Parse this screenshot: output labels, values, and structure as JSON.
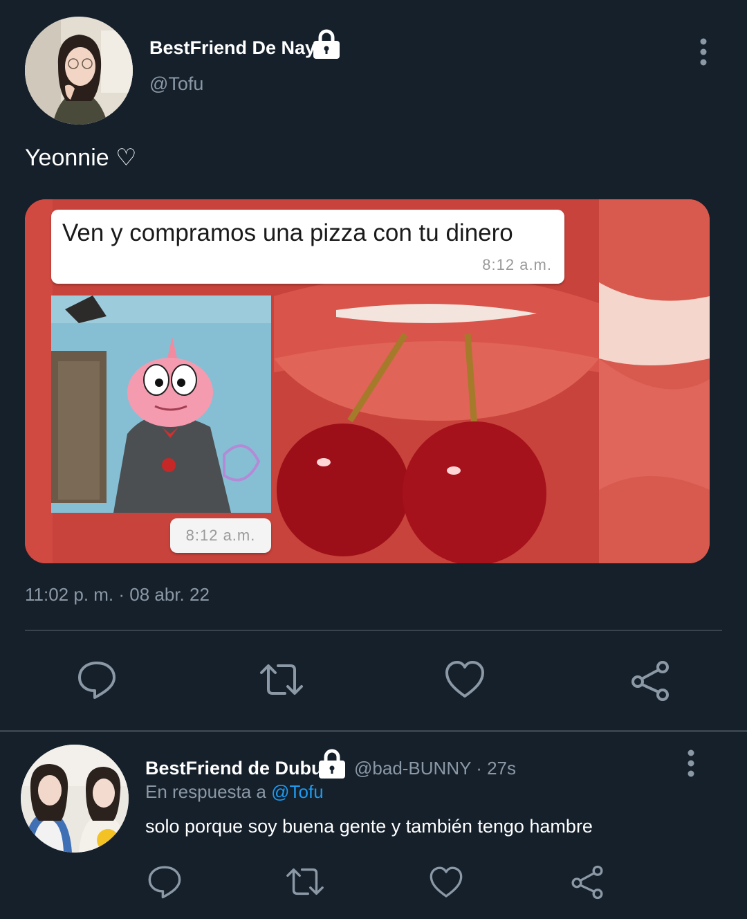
{
  "colors": {
    "background": "#15202b",
    "text_primary": "#ffffff",
    "text_secondary": "#8b98a5",
    "divider": "#38444d",
    "link": "#1d9bf0"
  },
  "main_tweet": {
    "display_name": "BestFriend De Nay",
    "handle": "@Tofu",
    "text": "Yeonnie ♡",
    "timestamp": "11:02 p. m. · 08 abr. 22",
    "media": {
      "top_message": "Ven y compramos una pizza con tu dinero",
      "top_time": "8:12 a.m.",
      "bottom_time": "8:12 a.m."
    },
    "icons": {
      "lock": "lock-icon",
      "more": "more-vertical-icon",
      "reply": "reply-icon",
      "retweet": "retweet-icon",
      "like": "heart-icon",
      "share": "share-icon"
    }
  },
  "reply_tweet": {
    "display_name": "BestFriend de Dubu",
    "handle_time": "@bad-BUNNY · 27s",
    "in_reply_prefix": "En respuesta a ",
    "in_reply_mention": "@Tofu",
    "text": "solo porque soy buena gente y también tengo hambre"
  }
}
